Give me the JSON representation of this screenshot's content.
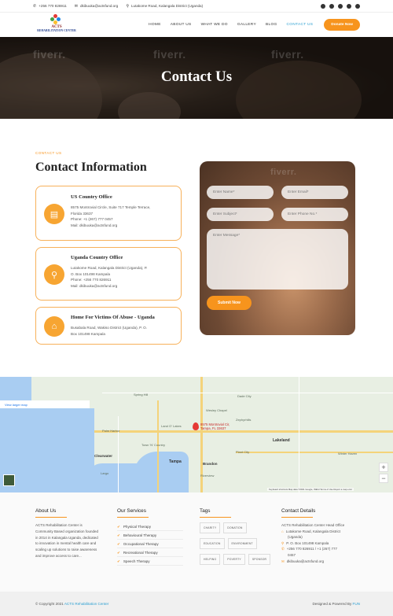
{
  "topbar": {
    "phone": "+256 770 826911",
    "email": "dkibuuka@actsfund.org",
    "address": "Lutakome Road, Kalangala District (Uganda)"
  },
  "brand": {
    "line1": "ACTS",
    "line2": "REHABILITATION CENTER"
  },
  "nav": {
    "items": [
      "HOME",
      "ABOUT US",
      "WHAT WE DO",
      "GALLERY",
      "BLOG",
      "CONTACT US"
    ],
    "active": "CONTACT US",
    "donate": "Donate Now"
  },
  "hero": {
    "title": "Contact Us",
    "watermark": "fiverr."
  },
  "contact": {
    "label": "CONTACT US",
    "title": "Contact Information",
    "cards": [
      {
        "title": "US Country Office",
        "lines": [
          "8575 Montrovial Circle, Suite 717 Temple Terrace,",
          "Florida 33637",
          "Phone: +1 (267) 777 0457",
          "Mail: dkibuuka@actsfund.org"
        ]
      },
      {
        "title": "Uganda Country Office",
        "lines": [
          "Lutakome Road, Kalangala District (Uganda), P.",
          "O. Box 101498 Kampala",
          "Phone: +256 770 826911",
          "Mail: dkibuuka@actsfund.org"
        ]
      },
      {
        "title": "Home For Victims Of Abuse - Uganda",
        "lines": [
          "Busabala Road, Wakiso District (Uganda), P. O.",
          "Box 101498 Kampala"
        ]
      }
    ]
  },
  "form": {
    "name": "Enter Name*",
    "email": "Enter Email*",
    "subject": "Enter Subject*",
    "phone": "Enter Phone No.*",
    "message": "Enter Message*",
    "submit": "Submit Now"
  },
  "map": {
    "larger": "View larger map",
    "pin_line1": "8575 Montrovial Cir,",
    "pin_line2": "Tampa, FL 33637",
    "cities": [
      "Tampa",
      "Clearwater",
      "Brandon",
      "Lakeland",
      "Plant City",
      "Riverview",
      "Wesley Chapel",
      "Town 'N' Country",
      "Largo",
      "Palm Harbor",
      "Spring Hill",
      "Dade City",
      "Zephyrhills",
      "Land O' Lakes",
      "Winter Haven"
    ],
    "footer": "Keyboard shortcuts   Map data ©2021 Google, INEGI   Terms of Use   Report a map error"
  },
  "footer": {
    "about": {
      "heading": "About Us",
      "text": [
        "ACTS Rehabilitation Center is",
        "Community Based organization founded",
        "in 2014 in Kalangala Uganda, dedicated",
        "to innovation in mental health care and",
        "scaling up solutions to raise awareness",
        "and improve access to care..."
      ]
    },
    "services": {
      "heading": "Our Services",
      "items": [
        "Physical Therapy",
        "Behavioural Therapy",
        "Occupational Therapy",
        "Recreational Therapy",
        "Speech Therapy"
      ]
    },
    "tags": {
      "heading": "Tags",
      "items": [
        "CHARITY",
        "DONATION",
        "EDUCATION",
        "ENVIRONMENT",
        "HELPING",
        "POVERTY",
        "SPONSOR"
      ]
    },
    "details": {
      "heading": "Contact Details",
      "lines": [
        "ACTS Rehabilitation Center Head Office",
        "Lutakome Road, Kalangala District",
        "(Uganda)",
        "P. O. Box 101498 Kampala",
        "+256 770 826911 / +1 (267) 777",
        "0457",
        "dkibuuka@actsfund.org"
      ]
    }
  },
  "copyright": {
    "left_prefix": "© Copyright 2021",
    "left_link": "ACTS Rehabilitation Center",
    "right_prefix": "Designed & Powered By",
    "right_link": "FUN"
  },
  "colors": {
    "accent": "#f7941d",
    "link": "#2b9fd1"
  }
}
